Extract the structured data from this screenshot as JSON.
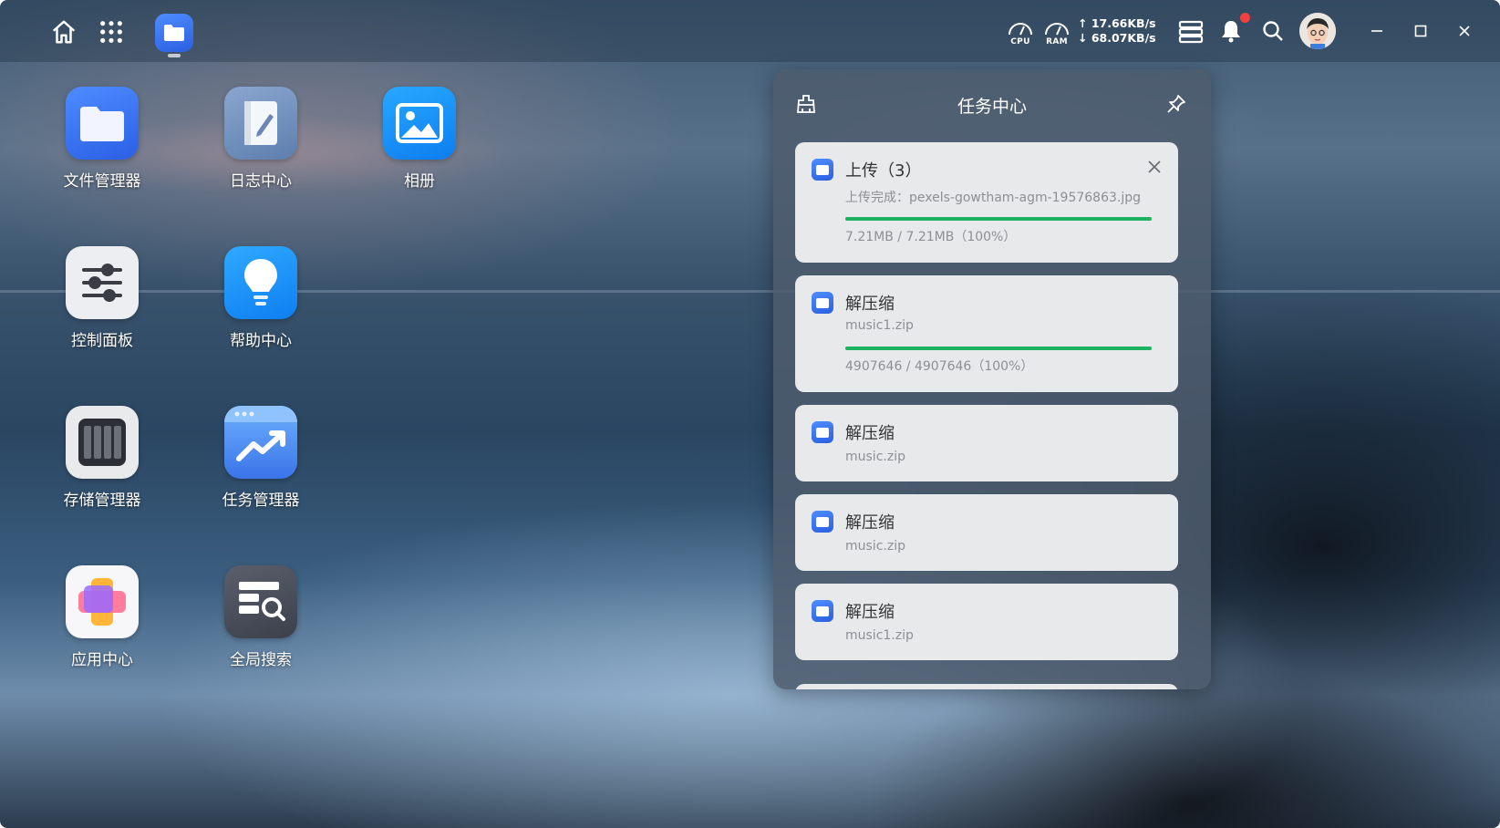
{
  "topbar": {
    "cpu_label": "CPU",
    "ram_label": "RAM",
    "upload_speed": "↑ 17.66KB/s",
    "download_speed": "↓ 68.07KB/s",
    "notification_badge_color": "#f04040"
  },
  "desktop_apps": [
    {
      "label": "文件管理器",
      "icon": "folder-icon"
    },
    {
      "label": "日志中心",
      "icon": "log-book-icon"
    },
    {
      "label": "相册",
      "icon": "photo-icon"
    },
    {
      "label": "控制面板",
      "icon": "sliders-icon"
    },
    {
      "label": "帮助中心",
      "icon": "lightbulb-icon"
    },
    {
      "label": "存储管理器",
      "icon": "storage-drives-icon"
    },
    {
      "label": "任务管理器",
      "icon": "trend-chart-icon"
    },
    {
      "label": "应用中心",
      "icon": "app-center-icon"
    },
    {
      "label": "全局搜索",
      "icon": "global-search-icon"
    }
  ],
  "task_center": {
    "title": "任务中心",
    "tasks": [
      {
        "name": "上传（3）",
        "desc": "上传完成：pexels-gowtham-agm-19576863.jpg",
        "progress_pct": 100,
        "progress_text": "7.21MB / 7.21MB（100%）"
      },
      {
        "name": "解压缩",
        "desc": "music1.zip",
        "progress_pct": 100,
        "progress_text": "4907646 / 4907646（100%）"
      },
      {
        "name": "解压缩",
        "desc": "music.zip"
      },
      {
        "name": "解压缩",
        "desc": "music.zip"
      },
      {
        "name": "解压缩",
        "desc": "music1.zip"
      }
    ]
  },
  "colors": {
    "accent_blue": "#2f6bf0",
    "progress_green": "#1bb35f"
  }
}
